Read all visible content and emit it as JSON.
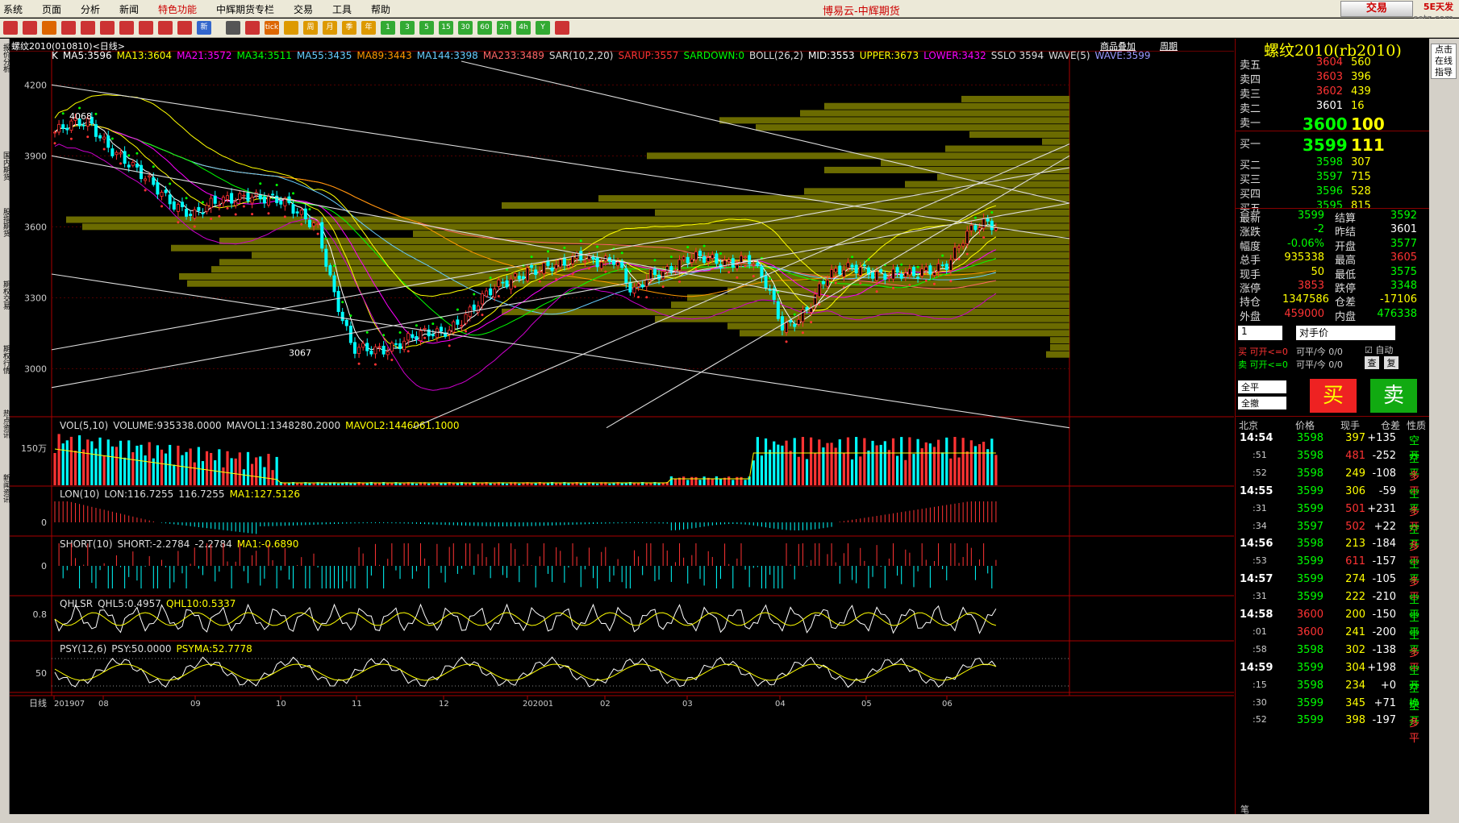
{
  "menu": {
    "items": [
      "系统",
      "页面",
      "分析",
      "新闻",
      "特色功能",
      "中辉期货专栏",
      "交易",
      "工具",
      "帮助"
    ],
    "title": "博易云-中辉期货",
    "trade": "交易",
    "logo": "5E天发",
    "logo_sub": "setz.com"
  },
  "toolbar": {
    "icons": [
      "back-icon",
      "home-icon",
      "page-icon",
      "doc-icon",
      "search-icon",
      "zoom-in-icon",
      "zoom-out-icon",
      "pen-icon",
      "draw-icon",
      "filter-icon",
      "new-icon",
      "table-icon",
      "curve-icon",
      "tick-icon",
      "week-icon",
      "calendar-icon",
      "month-icon",
      "season-icon",
      "year-icon",
      "min1-icon",
      "min3-icon",
      "min5-icon",
      "min15-icon",
      "min30-icon",
      "min60-icon",
      "hour2-icon",
      "hour4-icon",
      "y-icon",
      "window-icon"
    ],
    "labels": [
      "",
      "",
      "",
      "",
      "",
      "",
      "",
      "",
      "",
      "",
      "新",
      "",
      "",
      "tick",
      "",
      "周",
      "月",
      "季",
      "年",
      "1",
      "3",
      "5",
      "15",
      "30",
      "60",
      "2h",
      "4h",
      "Y",
      ""
    ]
  },
  "left_tabs": [
    "报价分析",
    "国内期货",
    "股指期货",
    "期权交易",
    "期权行情",
    "热点资讯",
    "新闻资讯"
  ],
  "chart": {
    "title": "螺纹2010(010810)<日线>",
    "links": [
      "商品叠加",
      "周期"
    ],
    "ma_legend": [
      {
        "t": "K",
        "c": "#fff"
      },
      {
        "t": "MA5:3596",
        "c": "#fff"
      },
      {
        "t": "MA13:3604",
        "c": "#ff0"
      },
      {
        "t": "MA21:3572",
        "c": "#f0f"
      },
      {
        "t": "MA34:3511",
        "c": "#0f0"
      },
      {
        "t": "MA55:3435",
        "c": "#6cf"
      },
      {
        "t": "MA89:3443",
        "c": "#f90"
      },
      {
        "t": "MA144:3398",
        "c": "#6cf"
      },
      {
        "t": "MA233:3489",
        "c": "#f66"
      },
      {
        "t": "SAR(10,2,20)",
        "c": "#ddd"
      },
      {
        "t": "SARUP:3557",
        "c": "#f33"
      },
      {
        "t": "SARDOWN:0",
        "c": "#0f0"
      },
      {
        "t": "BOLL(26,2)",
        "c": "#ddd"
      },
      {
        "t": "MID:3553",
        "c": "#fff"
      },
      {
        "t": "UPPER:3673",
        "c": "#ff0"
      },
      {
        "t": "LOWER:3432",
        "c": "#f0f"
      },
      {
        "t": "SSLO 3594",
        "c": "#ddd"
      },
      {
        "t": "WAVE(5)",
        "c": "#ddd"
      },
      {
        "t": "WAVE:3599",
        "c": "#99f"
      }
    ],
    "y_ticks": [
      "4200",
      "3900",
      "3600",
      "3300",
      "3000"
    ],
    "annot_high": "4068",
    "annot_low": "3067",
    "vol_legend": [
      {
        "t": "VOL(5,10)",
        "c": "#ddd"
      },
      {
        "t": "VOLUME:935338.0000",
        "c": "#ddd"
      },
      {
        "t": "MAVOL1:1348280.2000",
        "c": "#ddd"
      },
      {
        "t": "MAVOL2:1446061.1000",
        "c": "#ff0"
      }
    ],
    "vol_tick": "150万",
    "lon_legend": [
      {
        "t": "LON(10)",
        "c": "#ddd"
      },
      {
        "t": "LON:116.7255",
        "c": "#ddd"
      },
      {
        "t": "116.7255",
        "c": "#ddd"
      },
      {
        "t": "MA1:127.5126",
        "c": "#ff0"
      }
    ],
    "lon_tick": "0",
    "short_legend": [
      {
        "t": "SHORT(10)",
        "c": "#ddd"
      },
      {
        "t": "SHORT:-2.2784",
        "c": "#ddd"
      },
      {
        "t": "-2.2784",
        "c": "#ddd"
      },
      {
        "t": "MA1:-0.6890",
        "c": "#ff0"
      }
    ],
    "short_tick": "0",
    "qhl_legend": [
      {
        "t": "QHLSR",
        "c": "#ddd"
      },
      {
        "t": "QHL5:0.4957",
        "c": "#ddd"
      },
      {
        "t": "QHL10:0.5337",
        "c": "#ff0"
      }
    ],
    "qhl_tick": "0.8",
    "psy_legend": [
      {
        "t": "PSY(12,6)",
        "c": "#ddd"
      },
      {
        "t": "PSY:50.0000",
        "c": "#ddd"
      },
      {
        "t": "PSYMA:52.7778",
        "c": "#ff0"
      }
    ],
    "psy_tick": "50",
    "x_label": "日线",
    "x_ticks": [
      "201907",
      "08",
      "09",
      "10",
      "11",
      "12",
      "202001",
      "02",
      "03",
      "04",
      "05",
      "06"
    ]
  },
  "right": {
    "title": "螺纹2010(rb2010)",
    "asks": [
      {
        "l": "卖五",
        "p": "3604",
        "v": "560"
      },
      {
        "l": "卖四",
        "p": "3603",
        "v": "396"
      },
      {
        "l": "卖三",
        "p": "3602",
        "v": "439"
      },
      {
        "l": "卖二",
        "p": "3601",
        "v": "16"
      },
      {
        "l": "卖一",
        "p": "3600",
        "v": "100"
      }
    ],
    "bids": [
      {
        "l": "买一",
        "p": "3599",
        "v": "111"
      },
      {
        "l": "买二",
        "p": "3598",
        "v": "307"
      },
      {
        "l": "买三",
        "p": "3597",
        "v": "715"
      },
      {
        "l": "买四",
        "p": "3596",
        "v": "528"
      },
      {
        "l": "买五",
        "p": "3595",
        "v": "815"
      }
    ],
    "stats": [
      [
        "最新",
        "3599",
        "结算",
        "3592"
      ],
      [
        "涨跌",
        "-2",
        "昨结",
        "3601"
      ],
      [
        "幅度",
        "-0.06%",
        "开盘",
        "3577"
      ],
      [
        "总手",
        "935338",
        "最高",
        "3605"
      ],
      [
        "现手",
        "50",
        "最低",
        "3575"
      ],
      [
        "涨停",
        "3853",
        "跌停",
        "3348"
      ],
      [
        "持仓",
        "1347586",
        "仓差",
        "-17106"
      ],
      [
        "外盘",
        "459000",
        "内盘",
        "476338"
      ]
    ],
    "qty": "1",
    "price_type": "对手价",
    "buy_open": "买 可开<=0",
    "sell_open": "卖 可开<=0",
    "buy_close": "可平/今 0/0",
    "sell_close": "可平/今 0/0",
    "auto": "自动",
    "copy": "复",
    "check": "查",
    "all_close": "全平",
    "all_cancel": "全撤",
    "buy_btn": "买",
    "sell_btn": "卖",
    "tick_header": [
      "北京",
      "价格",
      "现手",
      "仓差",
      "性质"
    ],
    "ticks": [
      [
        "14:54",
        "3598",
        "397",
        "+135",
        "空开"
      ],
      [
        ":51",
        "3598",
        "481",
        "-252",
        "空平"
      ],
      [
        ":52",
        "3598",
        "249",
        "-108",
        "多平"
      ],
      [
        "14:55",
        "3599",
        "306",
        "-59",
        "空平"
      ],
      [
        ":31",
        "3599",
        "501",
        "+231",
        "多开"
      ],
      [
        ":34",
        "3597",
        "502",
        "+22",
        "空开"
      ],
      [
        "14:56",
        "3598",
        "213",
        "-184",
        "多平"
      ],
      [
        ":53",
        "3599",
        "611",
        "-157",
        "空平"
      ],
      [
        "14:57",
        "3599",
        "274",
        "-105",
        "多平"
      ],
      [
        ":31",
        "3599",
        "222",
        "-210",
        "空平"
      ],
      [
        "14:58",
        "3600",
        "200",
        "-150",
        "空平"
      ],
      [
        ":01",
        "3600",
        "241",
        "-200",
        "空平"
      ],
      [
        ":58",
        "3598",
        "302",
        "-138",
        "多平"
      ],
      [
        "14:59",
        "3599",
        "304",
        "+198",
        "空开"
      ],
      [
        ":15",
        "3598",
        "234",
        "+0",
        "空换"
      ],
      [
        ":30",
        "3599",
        "345",
        "+71",
        "空开"
      ],
      [
        ":52",
        "3599",
        "398",
        "-197",
        "多平"
      ]
    ],
    "bottom_tab": "笔"
  },
  "side_buttons": [
    "点击",
    "在线",
    "指导"
  ],
  "colors": {
    "up": "#ff3232",
    "down": "#00ffff",
    "accent": "#ffff00",
    "grid": "#800000",
    "bar": "#6b6b00"
  },
  "chart_data": {
    "type": "line",
    "xlabel": "日线",
    "x": [
      "201907",
      "08",
      "09",
      "10",
      "11",
      "12",
      "202001",
      "02",
      "03",
      "04",
      "05",
      "06"
    ],
    "price_ylim": [
      2800,
      4300
    ],
    "close_approx": [
      4000,
      3850,
      3680,
      3700,
      3090,
      3250,
      3480,
      3420,
      3470,
      3200,
      3440,
      3599
    ],
    "high": 4068,
    "low": 3067
  }
}
